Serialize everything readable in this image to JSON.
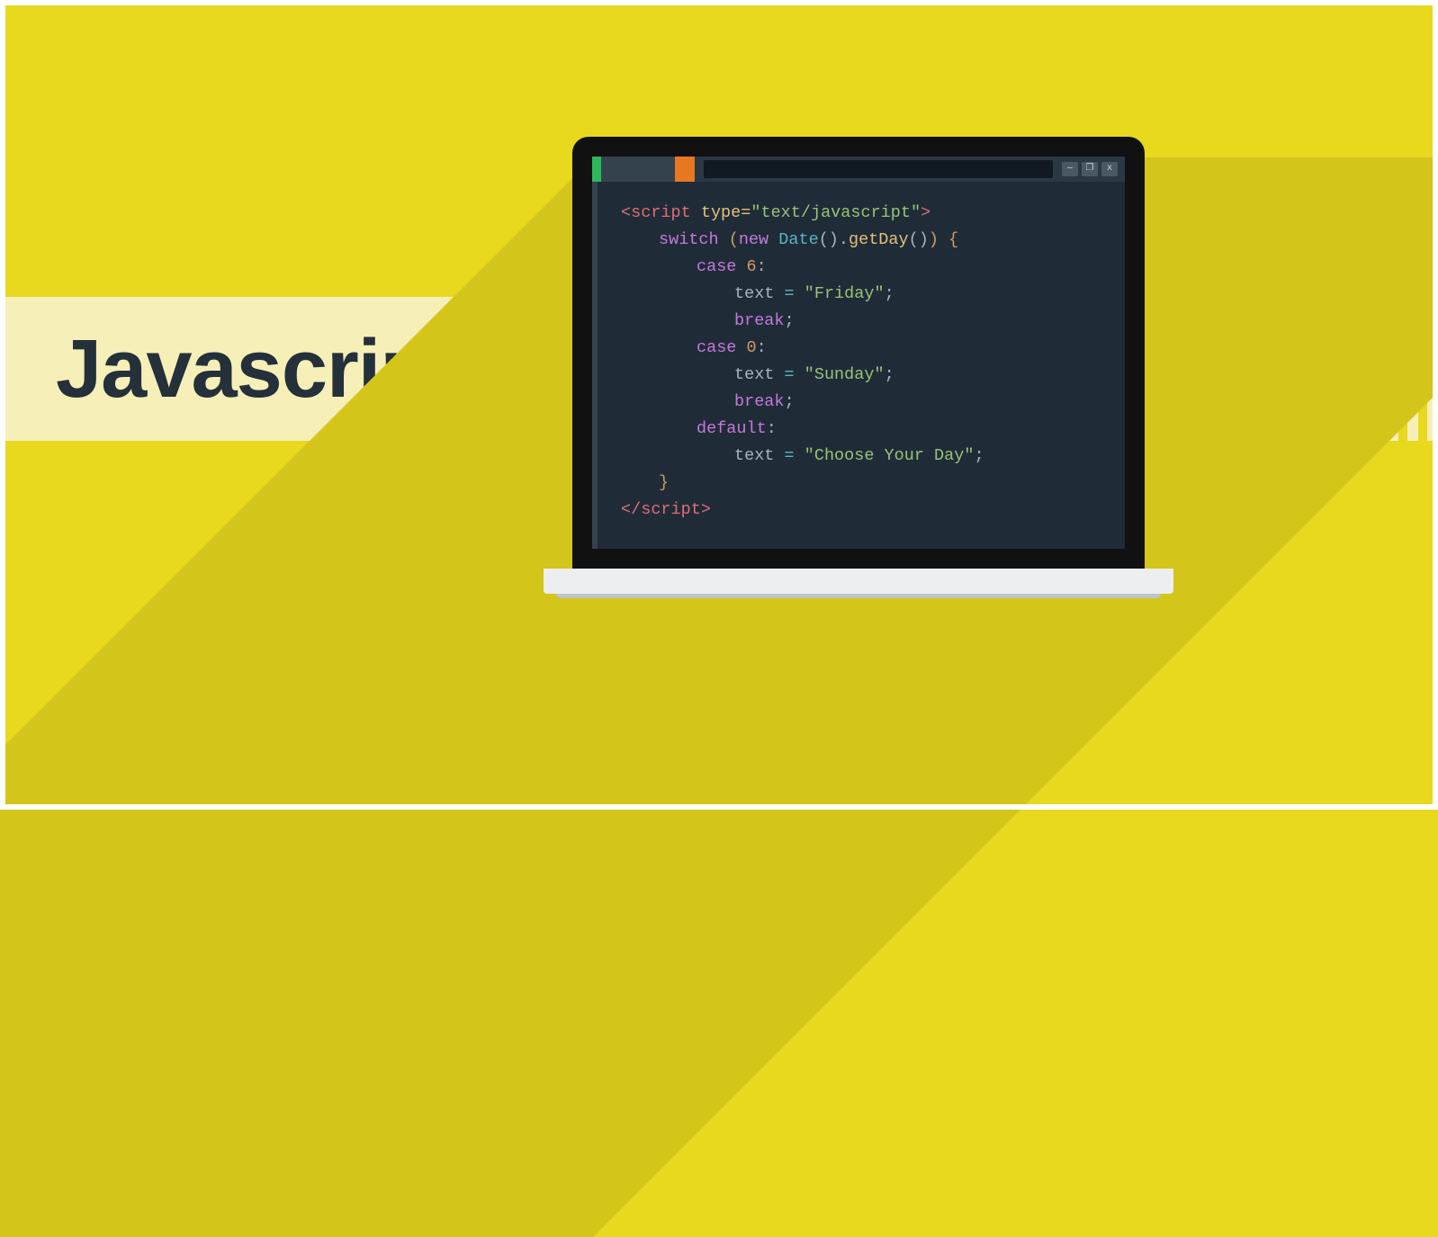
{
  "title": "Javascript",
  "code": {
    "open": {
      "lt": "<",
      "tag": "script",
      "sp": " ",
      "attr": "type=",
      "val": "\"text/javascript\"",
      "gt": ">"
    },
    "l1": {
      "kw": "switch",
      "paren_o": " (",
      "new": "new ",
      "type": "Date",
      "call1": "().",
      "fn": "getDay",
      "call2": "()",
      "paren_c": ") ",
      "brace": "{"
    },
    "l2": {
      "kw": "case ",
      "num": "6",
      "colon": ":"
    },
    "l3": {
      "var": "text ",
      "op": "= ",
      "str": "\"Friday\"",
      "semi": ";"
    },
    "l4": {
      "kw": "break",
      "semi": ";"
    },
    "l5": {
      "kw": "case ",
      "num": "0",
      "colon": ":"
    },
    "l6": {
      "var": "text ",
      "op": "= ",
      "str": "\"Sunday\"",
      "semi": ";"
    },
    "l7": {
      "kw": "break",
      "semi": ";"
    },
    "l8": {
      "kw": "default",
      "colon": ":"
    },
    "l9": {
      "var": "text ",
      "op": "= ",
      "str": "\"Choose Your Day\"",
      "semi": ";"
    },
    "l10": {
      "brace": "}"
    },
    "close": {
      "lt": "</",
      "tag": "script",
      "gt": ">"
    }
  },
  "win": {
    "min": "—",
    "max": "❐",
    "close": "x"
  }
}
